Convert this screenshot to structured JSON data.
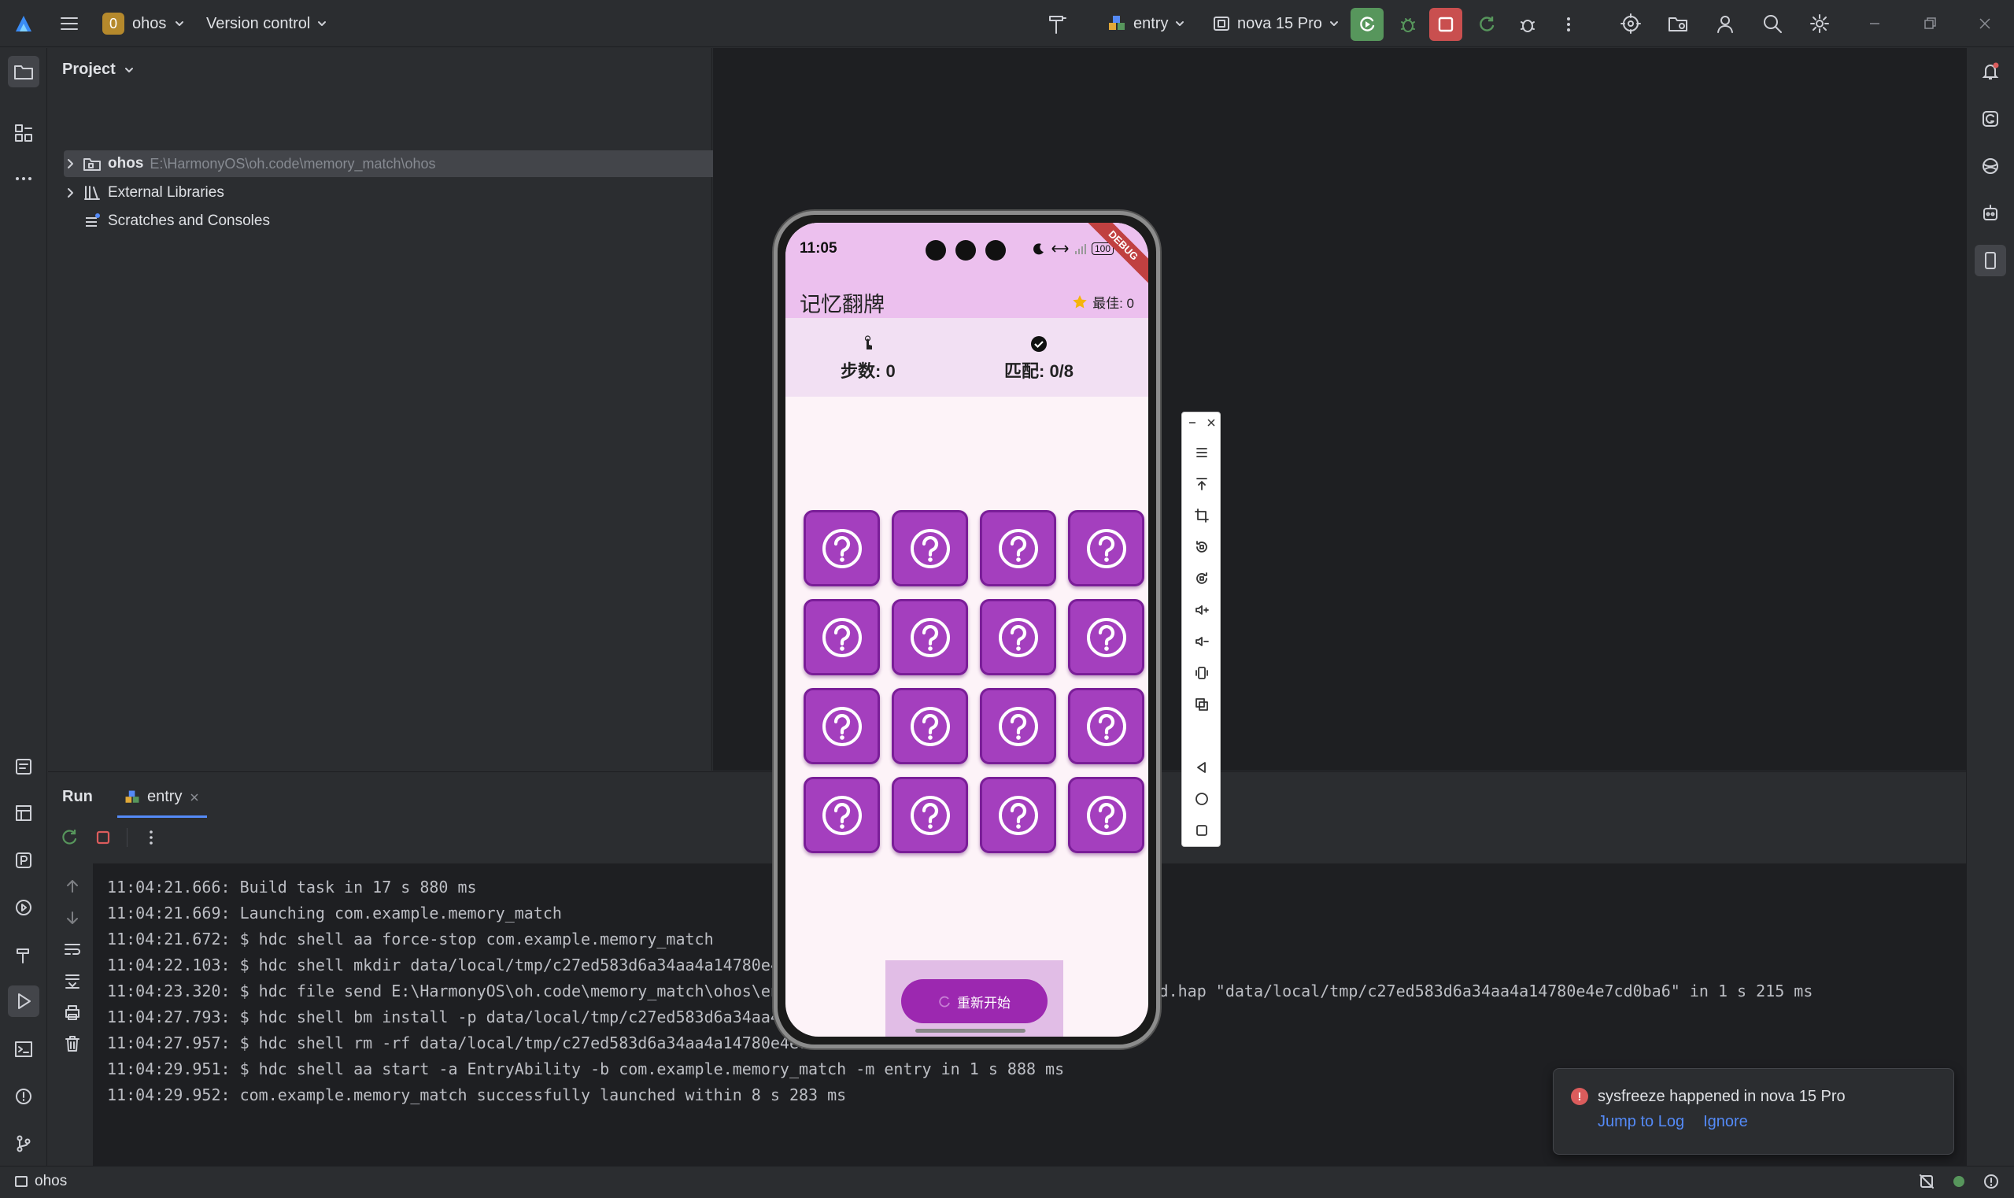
{
  "titlebar": {
    "project_badge": "0",
    "project_name": "ohos",
    "vcs_label": "Version control",
    "run_config": "entry",
    "device": "nova 15 Pro"
  },
  "project_panel": {
    "title": "Project",
    "tree": [
      {
        "name": "ohos",
        "path": "E:\\HarmonyOS\\oh.code\\memory_match\\ohos"
      },
      {
        "name": "External Libraries"
      },
      {
        "name": "Scratches and Consoles"
      }
    ]
  },
  "run_panel": {
    "title": "Run",
    "tab": "entry",
    "lines": [
      "11:04:21.666: Build task in 17 s 880 ms",
      "11:04:21.669: Launching com.example.memory_match",
      "11:04:21.672: $ hdc shell aa force-stop com.example.memory_match",
      "11:04:22.103: $ hdc shell mkdir data/local/tmp/c27ed583d6a34aa4a14780e4",
      "11:04:23.320: $ hdc file send E:\\HarmonyOS\\oh.code\\memory_match\\ohos\\en                          efault-unsigned.hap \"data/local/tmp/c27ed583d6a34aa4a14780e4e7cd0ba6\" in 1 s 215 ms",
      "11:04:27.793: $ hdc shell bm install -p data/local/tmp/c27ed583d6a34aa4a",
      "11:04:27.957: $ hdc shell rm -rf data/local/tmp/c27ed583d6a34aa4a14780e4e7cd0ba6",
      "11:04:29.951: $ hdc shell aa start -a EntryAbility -b com.example.memory_match -m entry in 1 s 888 ms",
      "11:04:29.952: com.example.memory_match successfully launched within 8 s 283 ms"
    ]
  },
  "phone": {
    "time": "11:05",
    "battery": "100",
    "ribbon": "DEBUG",
    "app_title": "记忆翻牌",
    "best_label": "最佳: 0",
    "steps_label": "步数: 0",
    "match_label": "匹配: 0/8",
    "card_count": 16,
    "restart_label": "重新开始"
  },
  "notification": {
    "title": "sysfreeze happened in nova 15 Pro",
    "jump": "Jump to Log",
    "ignore": "Ignore"
  },
  "statusbar": {
    "project": "ohos"
  },
  "colors": {
    "accent": "#548af7",
    "card": "#a43fbe",
    "appbar": "#ecc0ee",
    "run_button": "#57965c",
    "stop_button": "#c94f4f"
  }
}
